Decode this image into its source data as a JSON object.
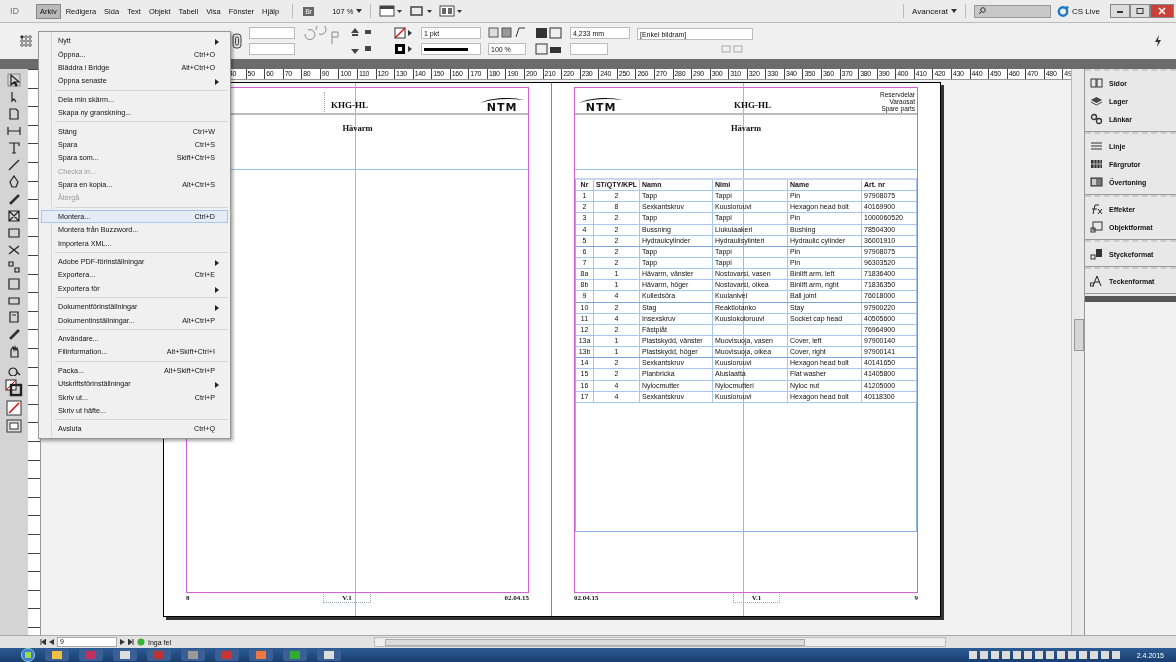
{
  "app_bar": {
    "logo": "ID",
    "menus": [
      {
        "label": "Arkiv",
        "selected": true
      },
      {
        "label": "Redigera",
        "selected": false
      },
      {
        "label": "Sida",
        "selected": false
      },
      {
        "label": "Text",
        "selected": false
      },
      {
        "label": "Objekt",
        "selected": false
      },
      {
        "label": "Tabell",
        "selected": false
      },
      {
        "label": "Visa",
        "selected": false
      },
      {
        "label": "Fönster",
        "selected": false
      },
      {
        "label": "Hjälp",
        "selected": false
      }
    ],
    "bridge": "Br",
    "zoom": "107 %",
    "workspace": "Avancerat",
    "cs_live": "CS Live"
  },
  "control_bar": {
    "stroke_weight": "1 pkt",
    "opacity": "100 %",
    "dimension": "4,233 mm",
    "frame_style": "[Enkel bildram]"
  },
  "file_menu": {
    "items": [
      {
        "kind": "item",
        "label": "Nytt",
        "submenu": true
      },
      {
        "kind": "item",
        "label": "Öppna...",
        "shortcut": "Ctrl+O"
      },
      {
        "kind": "item",
        "label": "Bläddra i Bridge",
        "shortcut": "Alt+Ctrl+O"
      },
      {
        "kind": "item",
        "label": "Öppna senaste",
        "submenu": true
      },
      {
        "kind": "separator"
      },
      {
        "kind": "item",
        "label": "Dela min skärm..."
      },
      {
        "kind": "item",
        "label": "Skapa ny granskning..."
      },
      {
        "kind": "separator"
      },
      {
        "kind": "item",
        "label": "Stäng",
        "shortcut": "Ctrl+W"
      },
      {
        "kind": "item",
        "label": "Spara",
        "shortcut": "Ctrl+S"
      },
      {
        "kind": "item",
        "label": "Spara som...",
        "shortcut": "Skift+Ctrl+S"
      },
      {
        "kind": "item",
        "label": "Checka in...",
        "disabled": true
      },
      {
        "kind": "item",
        "label": "Spara en kopia...",
        "shortcut": "Alt+Ctrl+S"
      },
      {
        "kind": "item",
        "label": "Återgå",
        "disabled": true
      },
      {
        "kind": "separator"
      },
      {
        "kind": "item",
        "label": "Montera...",
        "shortcut": "Ctrl+D",
        "selected": true
      },
      {
        "kind": "item",
        "label": "Montera från Buzzword..."
      },
      {
        "kind": "item",
        "label": "Importera XML..."
      },
      {
        "kind": "separator"
      },
      {
        "kind": "item",
        "label": "Adobe PDF-förinställningar",
        "submenu": true
      },
      {
        "kind": "item",
        "label": "Exportera...",
        "shortcut": "Ctrl+E"
      },
      {
        "kind": "item",
        "label": "Exportera för",
        "submenu": true
      },
      {
        "kind": "separator"
      },
      {
        "kind": "item",
        "label": "Dokumentförinställningar",
        "submenu": true
      },
      {
        "kind": "item",
        "label": "Dokumentinställningar...",
        "shortcut": "Alt+Ctrl+P"
      },
      {
        "kind": "separator"
      },
      {
        "kind": "item",
        "label": "Användare..."
      },
      {
        "kind": "item",
        "label": "Filinformation...",
        "shortcut": "Alt+Skift+Ctrl+I"
      },
      {
        "kind": "separator"
      },
      {
        "kind": "item",
        "label": "Packa...",
        "shortcut": "Alt+Skift+Ctrl+P"
      },
      {
        "kind": "item",
        "label": "Utskriftsförinställningar",
        "submenu": true
      },
      {
        "kind": "item",
        "label": "Skriv ut...",
        "shortcut": "Ctrl+P"
      },
      {
        "kind": "item",
        "label": "Skriv ut häfte..."
      },
      {
        "kind": "separator"
      },
      {
        "kind": "item",
        "label": "Avsluta",
        "shortcut": "Ctrl+Q"
      }
    ]
  },
  "ruler": {
    "marks": [
      "40",
      "50",
      "60",
      "70",
      "80",
      "90",
      "100",
      "110",
      "120",
      "130",
      "140",
      "150",
      "160",
      "170",
      "180",
      "190",
      "200",
      "210",
      "220",
      "230",
      "240",
      "250",
      "260",
      "270",
      "280",
      "290",
      "300",
      "310",
      "320",
      "330",
      "340",
      "350",
      "360",
      "370",
      "380",
      "390",
      "400",
      "410",
      "420",
      "430",
      "440",
      "450",
      "460",
      "470",
      "480",
      "49"
    ]
  },
  "left_page": {
    "logo": "NTM",
    "title": "KHG-HL",
    "heading": "Hävarm",
    "footer": {
      "page": "8",
      "version": "V.1",
      "date": "02.04.15"
    }
  },
  "right_page": {
    "logo": "NTM",
    "title": "KHG-HL",
    "header_lines": [
      "Reservdelar",
      "Varaosat",
      "Spare parts"
    ],
    "heading": "Hävarm",
    "table": {
      "columns": [
        "Nr",
        "ST/QTY/KPL",
        "Namn",
        "Nimi",
        "Name",
        "Art. nr"
      ],
      "rows": [
        [
          "1",
          "2",
          "Tapp",
          "Tappi",
          "Pin",
          "97908075"
        ],
        [
          "2",
          "8",
          "Sexkantskruv",
          "Kuusioruuvi",
          "Hexagon head bolt",
          "40169900"
        ],
        [
          "3",
          "2",
          "Tapp",
          "Tappi",
          "Pin",
          "1000060520"
        ],
        [
          "4",
          "2",
          "Bussning",
          "Liukulaakeri",
          "Bushing",
          "78504300"
        ],
        [
          "5",
          "2",
          "Hydraulcylinder",
          "Hydraulisylinteri",
          "Hydraulic cylinder",
          "36001910"
        ],
        [
          "6",
          "2",
          "Tapp",
          "Tappi",
          "Pin",
          "97908075"
        ],
        [
          "7",
          "2",
          "Tapp",
          "Tappi",
          "Pin",
          "96303520"
        ],
        [
          "8a",
          "1",
          "Hävarm, vänster",
          "Nostovarsi, vasen",
          "Binlift arm, left",
          "71836400"
        ],
        [
          "8b",
          "1",
          "Hävarm, höger",
          "Nostovarsi, oikea",
          "Binlift arm, right",
          "71836350"
        ],
        [
          "9",
          "4",
          "Kulledsöra",
          "Kuulanivel",
          "Ball joint",
          "76018000"
        ],
        [
          "10",
          "2",
          "Stag",
          "Reaktiotanko",
          "Stay",
          "97900220"
        ],
        [
          "11",
          "4",
          "Insexskruv",
          "Kuusiokoloruuvi",
          "Socket cap head",
          "40505600"
        ],
        [
          "12",
          "2",
          "Fästplåt",
          "",
          "",
          "76964900"
        ],
        [
          "13a",
          "1",
          "Plastskydd, vänster",
          "Muovisuoja, vasen",
          "Cover, left",
          "97900140"
        ],
        [
          "13b",
          "1",
          "Plastskydd, höger",
          "Muovisuoja, oikea",
          "Cover, right",
          "97900141"
        ],
        [
          "14",
          "2",
          "Sexkantskruv",
          "Kuusioruuvi",
          "Hexagon head bolt",
          "40141650"
        ],
        [
          "15",
          "2",
          "Planbricka",
          "Aluslaatta",
          "Flat washer",
          "41405800"
        ],
        [
          "16",
          "4",
          "Nylocmutter",
          "Nylocmutteri",
          "Nyloc nut",
          "41205000"
        ],
        [
          "17",
          "4",
          "Sexkantskruv",
          "Kuusioruuvi",
          "Hexagon head bolt",
          "40118300"
        ]
      ]
    },
    "footer": {
      "date": "02.04.15",
      "version": "V.1",
      "page": "9"
    }
  },
  "panels": [
    [
      {
        "label": "Sidor",
        "kind": "pages"
      },
      {
        "label": "Lager",
        "kind": "layers"
      },
      {
        "label": "Länkar",
        "kind": "links"
      }
    ],
    [
      {
        "label": "Linje",
        "kind": "stroke"
      },
      {
        "label": "Färgrutor",
        "kind": "swatches"
      },
      {
        "label": "Övertoning",
        "kind": "gradient"
      }
    ],
    [
      {
        "label": "Effekter",
        "kind": "effects"
      },
      {
        "label": "Objektformat",
        "kind": "objstyle"
      }
    ],
    [
      {
        "label": "Styckeformat",
        "kind": "parastyle"
      }
    ],
    [
      {
        "label": "Teckenformat",
        "kind": "charstyle"
      }
    ]
  ],
  "status_bar": {
    "page": "9",
    "errors": "Inga fel"
  },
  "taskbar": {
    "date": "2.4.2015"
  }
}
